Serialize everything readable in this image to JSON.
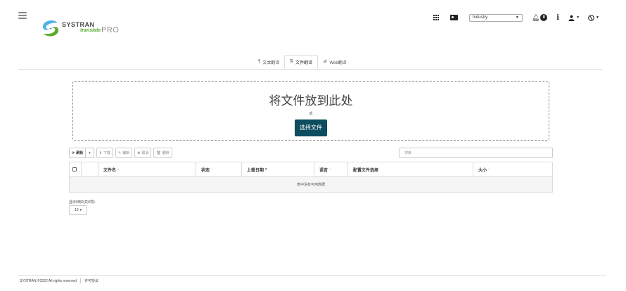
{
  "header": {
    "logo": {
      "brand": "SYSTRAN",
      "product": "translate",
      "edition": "PRO"
    },
    "industry": "Industry",
    "notification_count": "0",
    "icons": [
      "menu-icon",
      "apps-grid-icon",
      "id-card-icon",
      "bell-icon",
      "info-icon",
      "user-icon",
      "globe-icon"
    ]
  },
  "tabs": [
    {
      "icon": "¶",
      "label": "文本翻译",
      "active": false
    },
    {
      "icon": "⎘",
      "label": "文件翻译",
      "active": true
    },
    {
      "icon": "🔗",
      "label": "Web翻译",
      "active": false
    }
  ],
  "dropzone": {
    "title": "将文件放到此处",
    "or": "或",
    "button": "选择文件"
  },
  "toolbar": {
    "refresh": "刷新",
    "download": "下载",
    "edit": "编辑",
    "cancel": "取消",
    "delete": "删除",
    "search_placeholder": "搜索"
  },
  "table": {
    "columns": [
      {
        "label": "文件名",
        "sort": "↕"
      },
      {
        "label": "状态",
        "sort": "↕"
      },
      {
        "label": "上载日期",
        "sort": "▾"
      },
      {
        "label": "语言",
        "sort": "↕"
      },
      {
        "label": "配置文件选择",
        "sort": ""
      },
      {
        "label": "大小",
        "sort": "↕"
      }
    ],
    "empty": "表中没有可用数据"
  },
  "pagination": {
    "info": "显示0到0(共0项)",
    "page_size": "10"
  },
  "footer": {
    "copyright": "SYSTRAN ©2022 All rights reserved",
    "license": "许可协议"
  },
  "colors": {
    "primary_button": "#0c4d5f",
    "logo_green": "#5aab2e"
  }
}
